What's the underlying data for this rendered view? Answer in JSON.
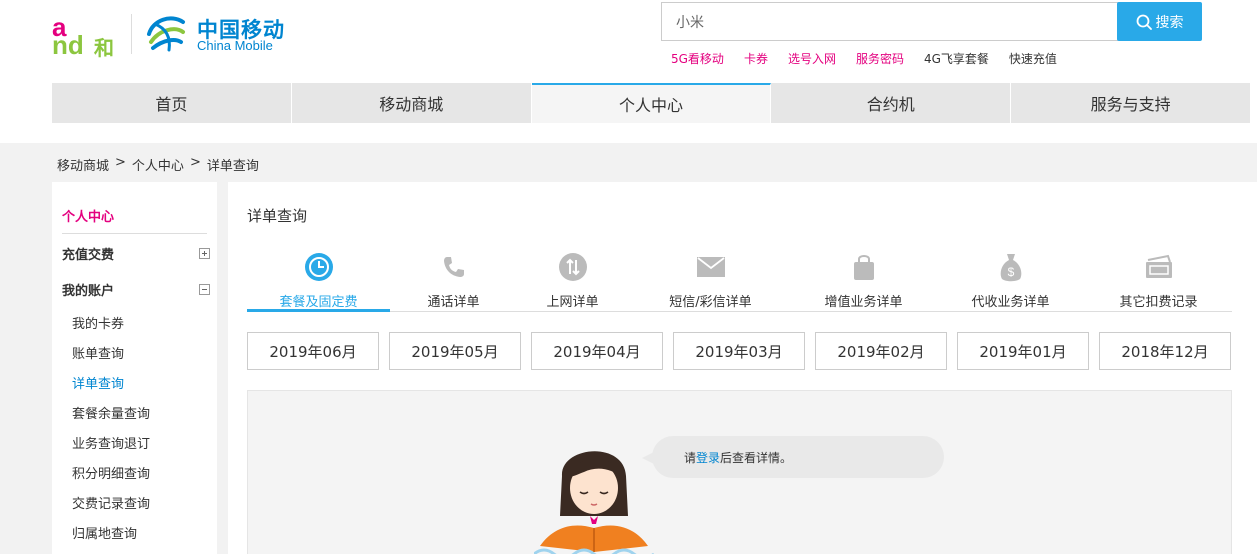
{
  "header": {
    "logo_and": {
      "a": "a",
      "n": "nd",
      "he": "和"
    },
    "logo_cm": {
      "cn": "中国移动",
      "en": "China Mobile"
    },
    "search": {
      "value": "小米",
      "button_label": "搜索"
    },
    "hot_links": [
      {
        "label": "5G看移动",
        "color": "#e4007f"
      },
      {
        "label": "卡券",
        "color": "#e4007f"
      },
      {
        "label": "选号入网",
        "color": "#e4007f"
      },
      {
        "label": "服务密码",
        "color": "#e4007f"
      },
      {
        "label": "4G飞享套餐",
        "color": "#333333"
      },
      {
        "label": "快速充值",
        "color": "#333333"
      }
    ],
    "nav": [
      {
        "label": "首页",
        "active": false
      },
      {
        "label": "移动商城",
        "active": false
      },
      {
        "label": "个人中心",
        "active": true
      },
      {
        "label": "合约机",
        "active": false
      },
      {
        "label": "服务与支持",
        "active": false
      }
    ]
  },
  "breadcrumb": [
    "移动商城",
    ">",
    "个人中心",
    ">",
    "详单查询"
  ],
  "sidebar": {
    "title": "个人中心",
    "groups": [
      {
        "label": "充值交费",
        "expanded": false
      },
      {
        "label": "我的账户",
        "expanded": true
      }
    ],
    "items": [
      {
        "label": "我的卡券",
        "active": false
      },
      {
        "label": "账单查询",
        "active": false
      },
      {
        "label": "详单查询",
        "active": true
      },
      {
        "label": "套餐余量查询",
        "active": false
      },
      {
        "label": "业务查询退订",
        "active": false
      },
      {
        "label": "积分明细查询",
        "active": false
      },
      {
        "label": "交费记录查询",
        "active": false
      },
      {
        "label": "归属地查询",
        "active": false
      }
    ]
  },
  "main": {
    "title": "详单查询",
    "tabs": [
      {
        "label": "套餐及固定费",
        "icon": "clock-icon",
        "active": true
      },
      {
        "label": "通话详单",
        "icon": "phone-icon",
        "active": false
      },
      {
        "label": "上网详单",
        "icon": "data-transfer-icon",
        "active": false
      },
      {
        "label": "短信/彩信详单",
        "icon": "envelope-icon",
        "active": false
      },
      {
        "label": "增值业务详单",
        "icon": "shopping-bag-icon",
        "active": false
      },
      {
        "label": "代收业务详单",
        "icon": "money-bag-icon",
        "active": false
      },
      {
        "label": "其它扣费记录",
        "icon": "card-icon",
        "active": false
      }
    ],
    "months": [
      "2019年06月",
      "2019年05月",
      "2019年04月",
      "2019年03月",
      "2019年02月",
      "2019年01月",
      "2018年12月"
    ],
    "notice": {
      "before": "请",
      "link": "登录",
      "after": "后查看详情。"
    }
  },
  "colors": {
    "accent": "#29a9e8",
    "brand_pink": "#e4007f",
    "brand_green": "#8cc63f",
    "brand_blue": "#0085d0"
  }
}
